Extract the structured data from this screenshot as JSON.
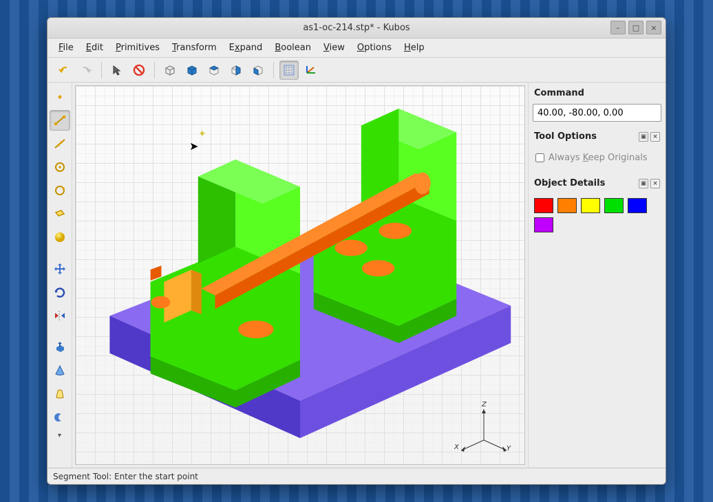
{
  "window": {
    "title": "as1-oc-214.stp* - Kubos"
  },
  "menu": {
    "file": "File",
    "edit": "Edit",
    "primitives": "Primitives",
    "transform": "Transform",
    "expand": "Expand",
    "boolean": "Boolean",
    "view": "View",
    "options": "Options",
    "help": "Help"
  },
  "toolbar_top": {
    "icons": [
      "undo",
      "redo",
      "pointer",
      "stop",
      "cube-wire",
      "cube-front",
      "cube-top",
      "cube-iso",
      "cube-side",
      "grid",
      "axes-origin"
    ]
  },
  "toolbar_left": {
    "icons": [
      "point",
      "segment",
      "line",
      "circle",
      "circle-point",
      "rect",
      "sphere",
      "spacer",
      "move",
      "rotate",
      "mirror",
      "spacer",
      "extrude",
      "cone",
      "loft",
      "boolean-sub"
    ]
  },
  "panels": {
    "command_label": "Command",
    "command_value": "40.00, -80.00, 0.00",
    "tool_options_label": "Tool Options",
    "always_keep": "Always Keep Originals",
    "always_keep_key": "K",
    "object_details_label": "Object Details",
    "colors": [
      "#ff0000",
      "#ff8000",
      "#ffff00",
      "#00e000",
      "#0000ff",
      "#c000ff"
    ]
  },
  "statusbar": {
    "text": "Segment Tool: Enter the start point"
  },
  "axis_labels": {
    "x": "X",
    "y": "Y",
    "z": "Z"
  }
}
